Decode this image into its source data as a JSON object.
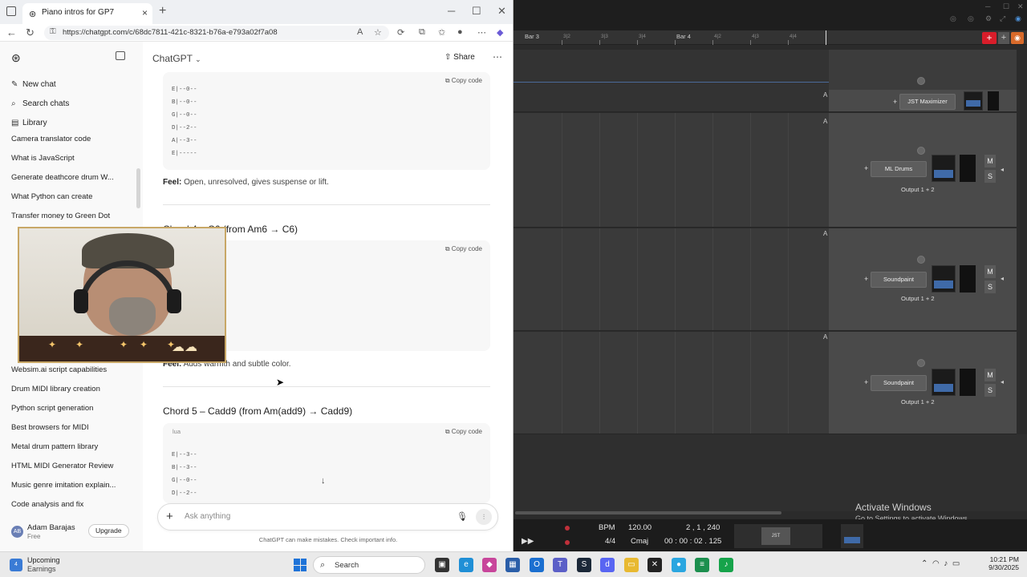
{
  "browser": {
    "tab_title": "Piano intros for GP7",
    "url": "https://chatgpt.com/c/68dc7811-421c-8321-b76a-e793a02f7a08"
  },
  "sidebar": {
    "new_chat": "New chat",
    "search_chats": "Search chats",
    "library": "Library",
    "chats": [
      "Camera translator code",
      "What is JavaScript",
      "Generate deathcore drum W...",
      "What Python can create",
      "Transfer money to Green Dot",
      "Websim.ai script capabilities",
      "Drum MIDI library creation",
      "Python script generation",
      "Best browsers for MIDI",
      "Metal drum pattern library",
      "HTML MIDI Generator Review",
      "Music genre imitation explain...",
      "Code analysis and fix"
    ],
    "user_initials": "AB",
    "user_name": "Adam Barajas",
    "user_plan": "Free",
    "upgrade": "Upgrade"
  },
  "chat": {
    "model": "ChatGPT",
    "share": "Share",
    "copy_code": "Copy code",
    "block1_lines": [
      "E|--0--",
      "B|--0--",
      "G|--0--",
      "D|--2--",
      "A|--3--",
      "E|-----"
    ],
    "feel1_label": "Feel:",
    "feel1_text": " Open, unresolved, gives suspense or lift.",
    "chord4_heading": "Chord 4 – C6 (from Am6 → C6)",
    "feel2_label": "Feel:",
    "feel2_text": " Adds warmth and subtle color.",
    "chord5_heading": "Chord 5 – Cadd9 (from Am(add9) → Cadd9)",
    "block3_lang": "lua",
    "block3_lines": [
      "E|--3--",
      "B|--3--",
      "G|--0--",
      "D|--2--"
    ],
    "composer_placeholder": "Ask anything",
    "disclaimer": "ChatGPT can make mistakes. Check important info."
  },
  "daw": {
    "bars": [
      "Bar 3",
      "Bar 4"
    ],
    "beats_bar3": [
      "3|2",
      "3|3",
      "3|4"
    ],
    "beats_bar4": [
      "4|2",
      "4|3",
      "4|4"
    ],
    "master_plugin": "JST Maximizer",
    "tracks": [
      {
        "plugin": "ML Drums",
        "output": "Output 1 + 2"
      },
      {
        "plugin": "Soundpaint",
        "output": "Output 1 + 2"
      },
      {
        "plugin": "Soundpaint",
        "output": "Output 1 + 2"
      }
    ],
    "mute_label": "M",
    "solo_label": "S",
    "automation_label": "A",
    "transport": {
      "bpm_label": "BPM",
      "bpm": "120.00",
      "position": "2 , 1 , 240",
      "time_sig": "4/4",
      "key": "Cmaj",
      "time": "00 : 00 : 02 . 125",
      "mini_plugin": "JST Maximizer"
    },
    "activate_title": "Activate Windows",
    "activate_sub": "Go to Settings to activate Windows."
  },
  "taskbar": {
    "weather_badge": "4",
    "weather_title": "Upcoming",
    "weather_sub": "Earnings",
    "search": "Search",
    "time": "10:21 PM",
    "date": "9/30/2025"
  },
  "colors": {
    "record_red": "#d81d2a",
    "meter_blue": "#3f6aa8",
    "windows_blue": "#1e73d8"
  }
}
